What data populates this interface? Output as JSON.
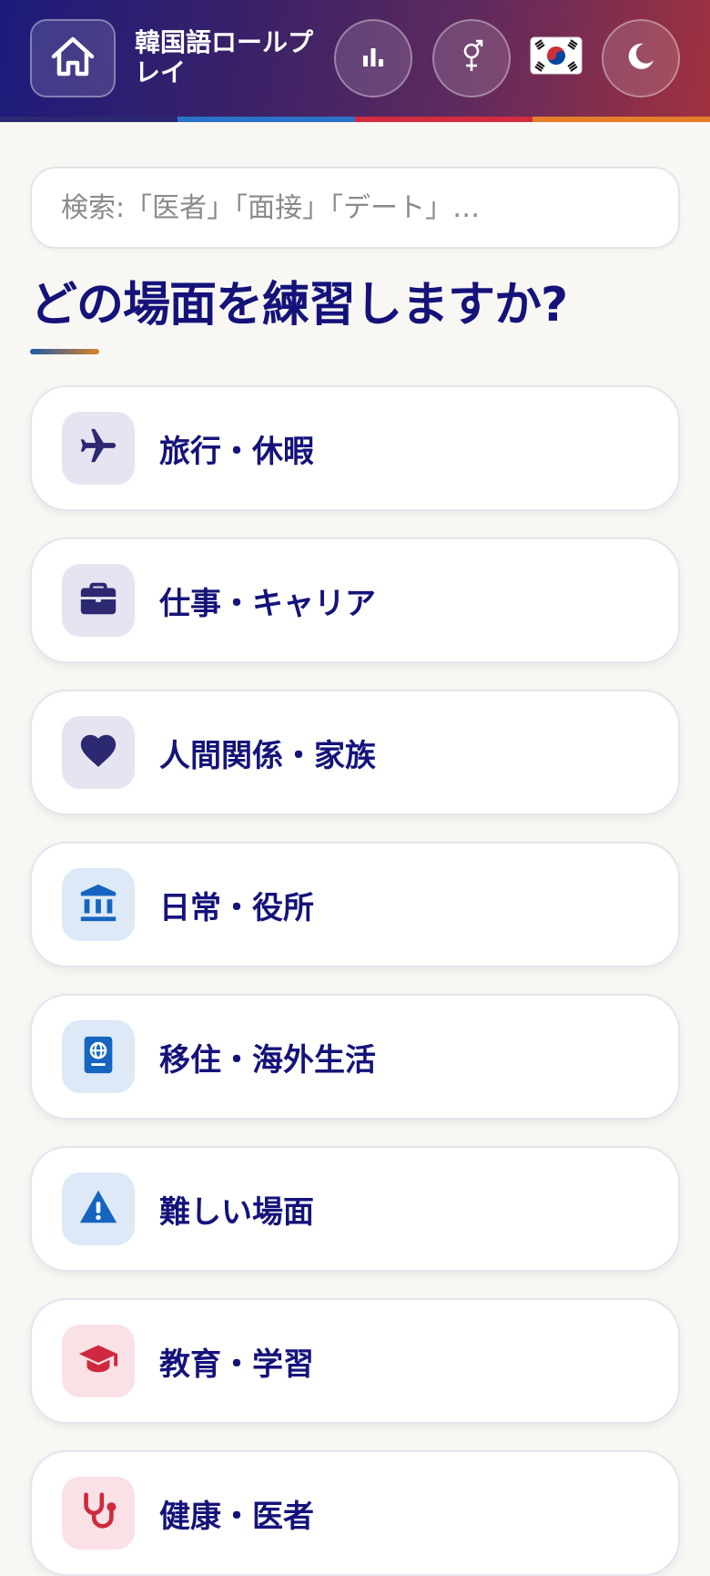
{
  "header": {
    "title": "韓国語ロールプレイ",
    "stripe_colors": [
      "#2c2872",
      "#2a73c9",
      "#d42c3f",
      "#e47e2b"
    ],
    "buttons": {
      "home_icon": "home-icon",
      "stats_icon": "bar-chart-icon",
      "gender_icon": "gender-icon",
      "flag_icon": "korea-flag-icon",
      "theme_icon": "moon-icon"
    }
  },
  "search": {
    "placeholder": "検索:「医者」「面接」「デート」…"
  },
  "main": {
    "heading": "どの場面を練習しますか?"
  },
  "categories": [
    {
      "label": "旅行・休暇",
      "icon": "airplane-icon",
      "icon_color": "#2c2872",
      "icon_bg": "#e5e4f0"
    },
    {
      "label": "仕事・キャリア",
      "icon": "briefcase-icon",
      "icon_color": "#2c2872",
      "icon_bg": "#e5e4f0"
    },
    {
      "label": "人間関係・家族",
      "icon": "heart-icon",
      "icon_color": "#2c2872",
      "icon_bg": "#e5e4f0"
    },
    {
      "label": "日常・役所",
      "icon": "government-building-icon",
      "icon_color": "#1565c0",
      "icon_bg": "#dde9f6"
    },
    {
      "label": "移住・海外生活",
      "icon": "passport-icon",
      "icon_color": "#1565c0",
      "icon_bg": "#dde9f6"
    },
    {
      "label": "難しい場面",
      "icon": "warning-icon",
      "icon_color": "#1565c0",
      "icon_bg": "#dde9f6"
    },
    {
      "label": "教育・学習",
      "icon": "graduation-cap-icon",
      "icon_color": "#d0283e",
      "icon_bg": "#fae1e5"
    },
    {
      "label": "健康・医者",
      "icon": "stethoscope-icon",
      "icon_color": "#d0283e",
      "icon_bg": "#fae1e5"
    }
  ]
}
